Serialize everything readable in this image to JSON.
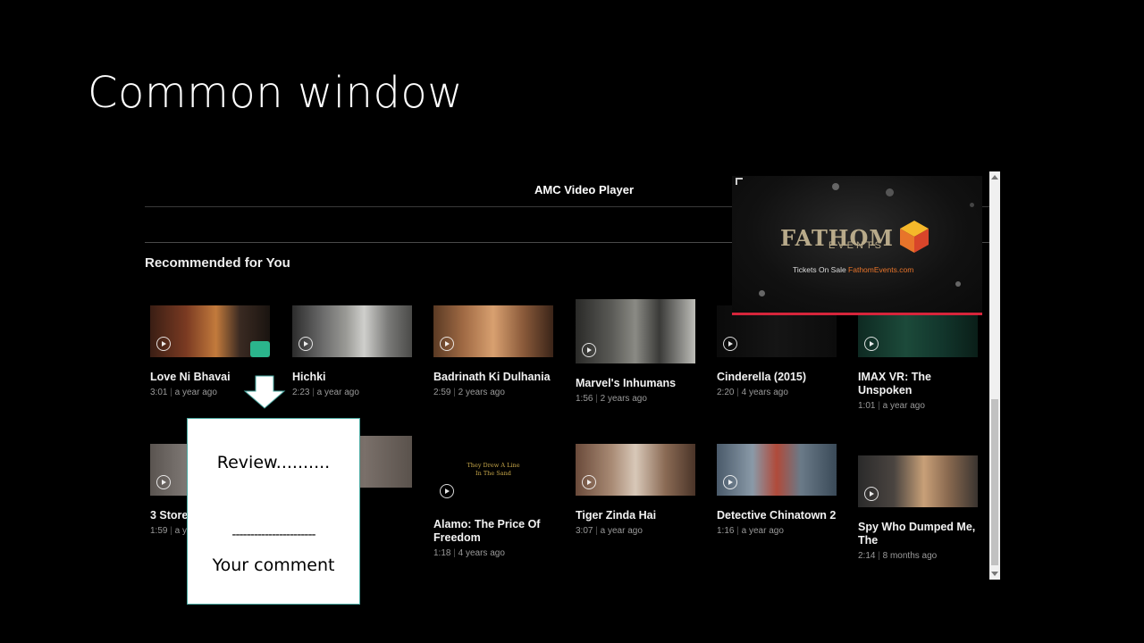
{
  "slide": {
    "title": "Common window"
  },
  "app": {
    "title": "AMC Video Player",
    "section_title": "Recommended for You"
  },
  "ad": {
    "logo_text": "FATHOM",
    "logo_sub": "EVENTS",
    "tagline_prefix": "Tickets On Sale ",
    "tagline_link": "FathomEvents.com",
    "accent_color": "#d6253b"
  },
  "videos_row1": [
    {
      "title": "Love Ni Bhavai",
      "duration": "3:01",
      "age": "a year ago"
    },
    {
      "title": "Hichki",
      "duration": "2:23",
      "age": "a year ago"
    },
    {
      "title": "Badrinath Ki Dulhania",
      "duration": "2:59",
      "age": "2 years ago"
    },
    {
      "title": "Marvel's Inhumans",
      "duration": "1:56",
      "age": "2 years ago"
    },
    {
      "title": "Cinderella (2015)",
      "duration": "2:20",
      "age": "4 years ago"
    },
    {
      "title": "IMAX VR: The Unspoken",
      "duration": "1:01",
      "age": "a year ago"
    }
  ],
  "videos_row2": [
    {
      "title": "3 Store",
      "duration": "1:59",
      "age": "a y"
    },
    {
      "title": "",
      "duration": "",
      "age": ""
    },
    {
      "title": "Alamo: The Price Of Freedom",
      "duration": "1:18",
      "age": "4 years ago",
      "thumb_text": "They Drew A Line In The Sand"
    },
    {
      "title": "Tiger Zinda Hai",
      "duration": "3:07",
      "age": "a year ago"
    },
    {
      "title": "Detective Chinatown 2",
      "duration": "1:16",
      "age": "a year ago"
    },
    {
      "title": "Spy Who Dumped Me, The",
      "duration": "2:14",
      "age": "8 months ago"
    }
  ],
  "review": {
    "title": "Review..........",
    "divider": "-----------------------",
    "comment_label": "Your comment"
  }
}
